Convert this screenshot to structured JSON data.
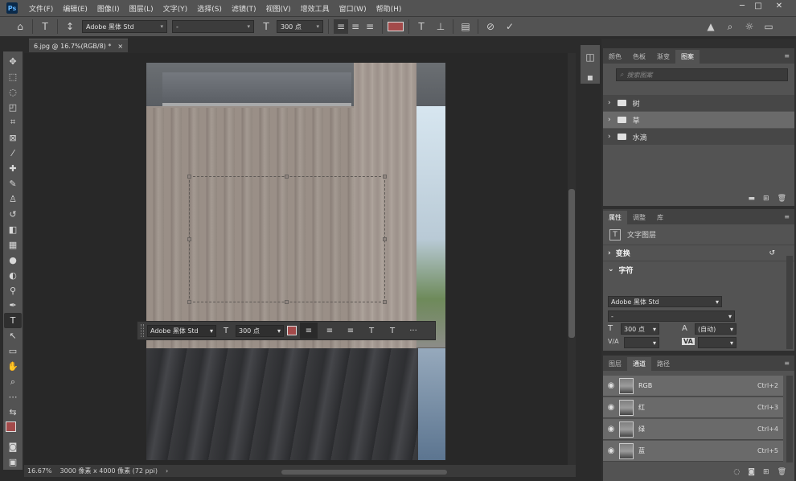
{
  "app_logo": "Ps",
  "menu": [
    "文件(F)",
    "编辑(E)",
    "图像(I)",
    "图层(L)",
    "文字(Y)",
    "选择(S)",
    "滤镜(T)",
    "视图(V)",
    "增效工具",
    "窗口(W)",
    "帮助(H)"
  ],
  "window_controls": {
    "minimize": "─",
    "restore": "□",
    "close": "✕"
  },
  "options": {
    "font_family": "Adobe 黑体 Std",
    "font_style": "-",
    "font_size": "300 点",
    "color": "#a34a4a"
  },
  "document_tab": {
    "title": "6.jpg @ 16.7%(RGB/8) *",
    "close": "×"
  },
  "context_bar": {
    "font_family": "Adobe 黑体 Std",
    "font_size": "300 点",
    "more": "···"
  },
  "status": {
    "zoom": "16.67%",
    "info": "3000 像素 x 4000 像素 (72 ppi)",
    "arrow": "›"
  },
  "patterns_panel": {
    "tabs": [
      "颜色",
      "色板",
      "渐变",
      "图案"
    ],
    "active_tab": 3,
    "search_placeholder": "搜索图案",
    "items": [
      {
        "label": "树",
        "selected": false
      },
      {
        "label": "草",
        "selected": true
      },
      {
        "label": "水滴",
        "selected": false
      }
    ]
  },
  "properties_panel": {
    "tabs": [
      "属性",
      "调整",
      "库"
    ],
    "active_tab": 0,
    "layer_type": "文字图层",
    "transform_label": "变换",
    "character_label": "字符",
    "font_family": "Adobe 黑体 Std",
    "font_style": "-",
    "font_size": "300 点",
    "leading": "(自动)",
    "va_label": "V/A",
    "va2_label": "VA"
  },
  "channels_panel": {
    "tabs": [
      "图层",
      "通道",
      "路径"
    ],
    "active_tab": 1,
    "channels": [
      {
        "name": "RGB",
        "shortcut": "Ctrl+2"
      },
      {
        "name": "红",
        "shortcut": "Ctrl+3"
      },
      {
        "name": "绿",
        "shortcut": "Ctrl+4"
      },
      {
        "name": "蓝",
        "shortcut": "Ctrl+5"
      }
    ]
  }
}
